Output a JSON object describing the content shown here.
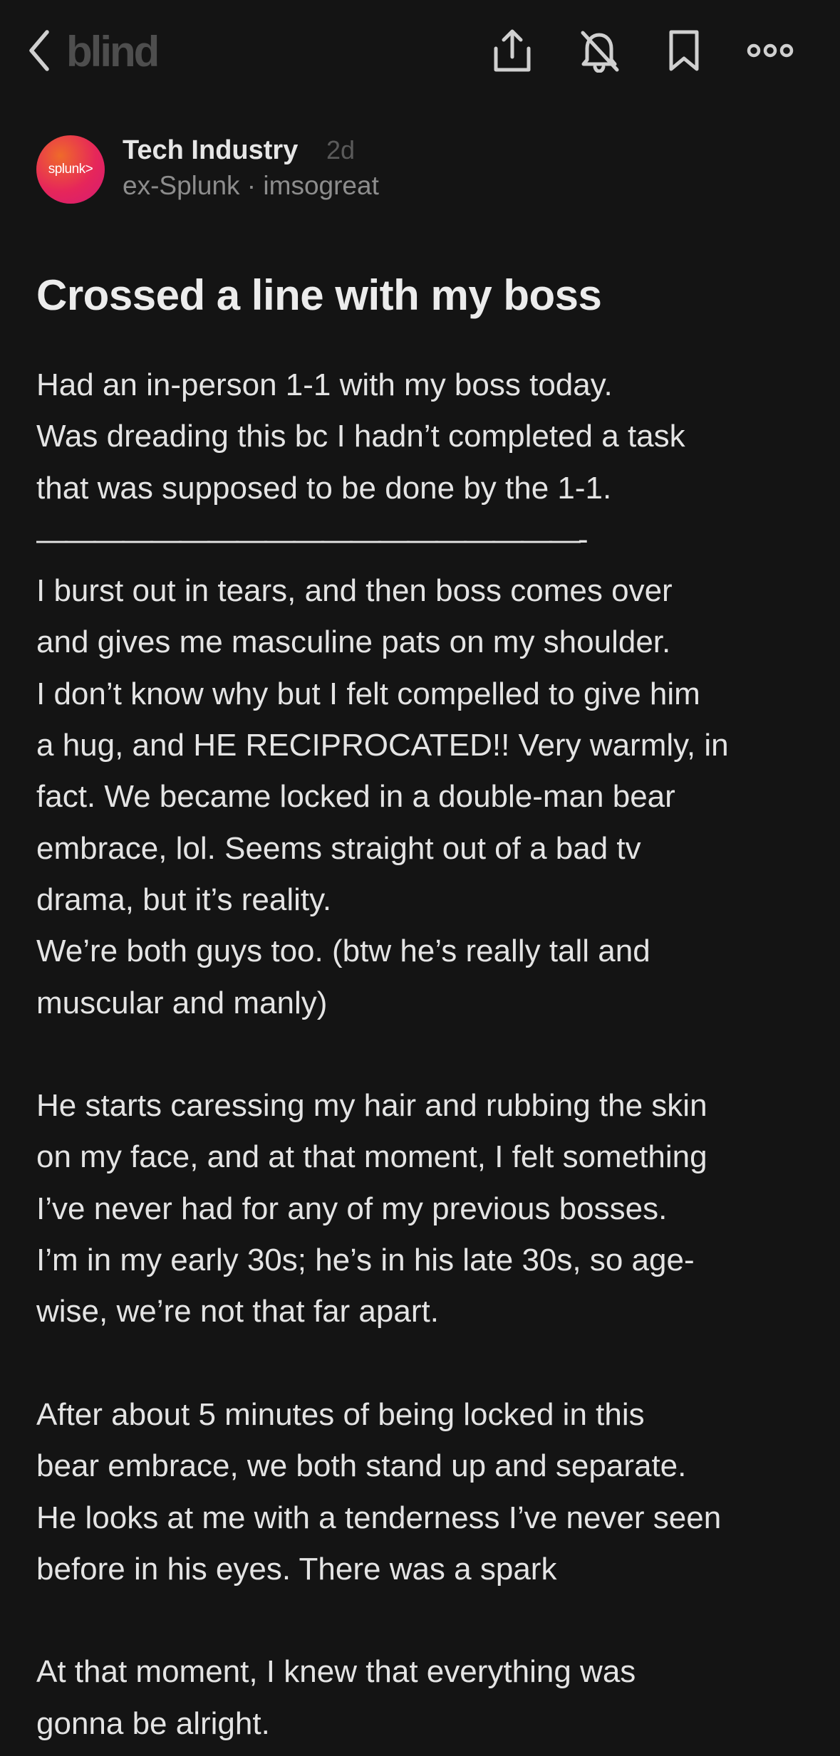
{
  "header": {
    "logo": "blind",
    "icons": [
      "chevron-left-icon",
      "share-icon",
      "bell-off-icon",
      "bookmark-icon",
      "more-icon"
    ]
  },
  "author": {
    "avatar_text": "splunk>",
    "community": "Tech Industry",
    "time": "2d",
    "meta": "ex-Splunk · imsogreat"
  },
  "post": {
    "title": "Crossed a line with my boss",
    "lines": [
      "Had an in-person 1-1 with my boss today.",
      "Was dreading this bc I hadn’t completed a task",
      "that was supposed to be done by the 1-1.",
      "———————————————————-",
      "I burst out in tears, and then boss comes over",
      "and gives me masculine pats on my shoulder.",
      "I don’t know why but I felt compelled to give him",
      "a hug, and HE RECIPROCATED!! Very warmly, in",
      "fact. We became locked in a double-man bear",
      "embrace, lol. Seems straight out of a bad tv",
      "drama, but it’s reality.",
      "We’re both guys too. (btw he’s really tall and",
      "muscular and manly)",
      "",
      "He starts caressing my hair and rubbing the skin",
      "on my face, and at that moment, I felt something",
      "I’ve never had for any of my previous bosses.",
      "I’m in my early 30s; he’s in his late 30s, so age-",
      "wise, we’re not that far apart.",
      "",
      "After about 5 minutes of being locked in this",
      "bear embrace, we both stand up and separate.",
      "He looks at me with a tenderness I’ve never seen",
      "before in his eyes. There was a spark",
      "",
      "At that moment, I knew that everything was",
      "gonna be alright."
    ]
  }
}
